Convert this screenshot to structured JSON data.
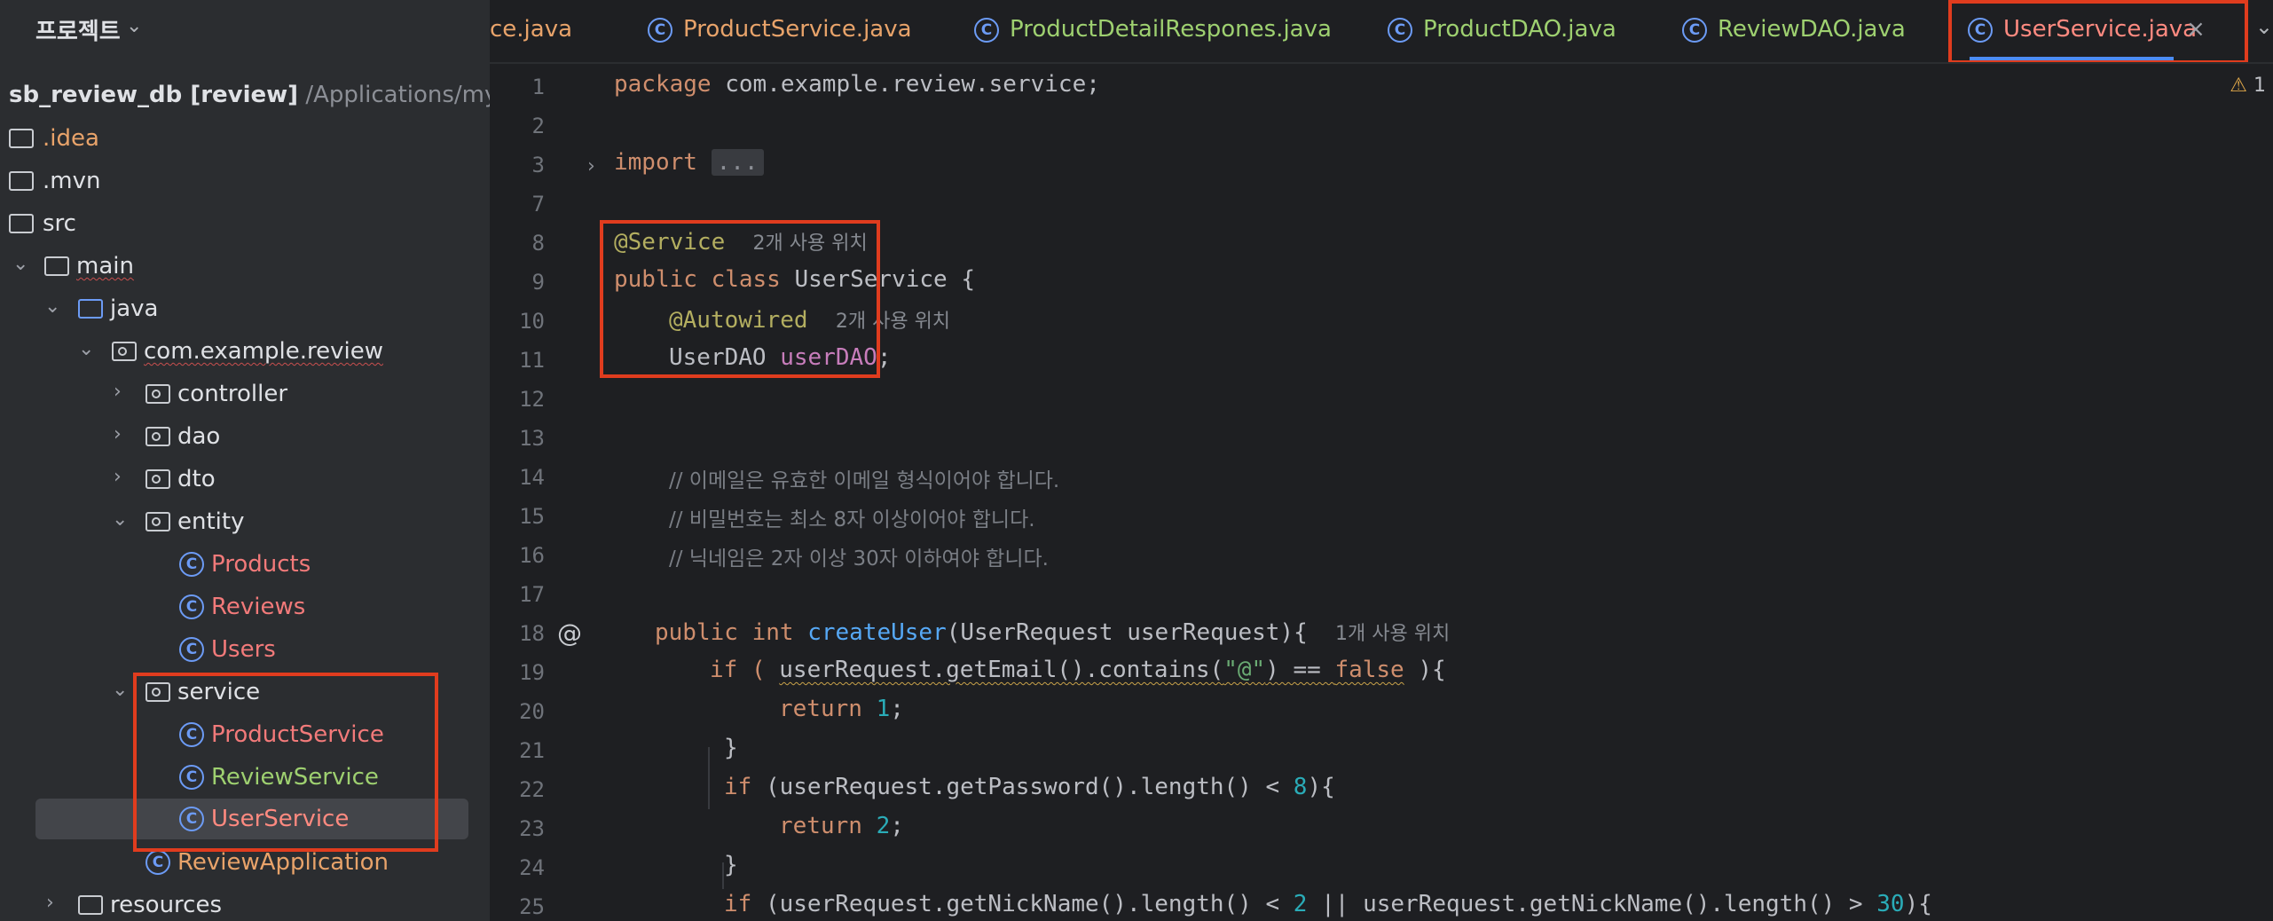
{
  "project_panel": {
    "title": "프로젝트",
    "root": {
      "name": "sb_review_db [review]",
      "path": "/Applications/mybear"
    },
    "items": [
      {
        "label": ".idea"
      },
      {
        "label": ".mvn"
      },
      {
        "label": "src"
      },
      {
        "label": "main"
      },
      {
        "label": "java"
      },
      {
        "label": "com.example.review"
      },
      {
        "label": "controller"
      },
      {
        "label": "dao"
      },
      {
        "label": "dto"
      },
      {
        "label": "entity"
      },
      {
        "label": "Products"
      },
      {
        "label": "Reviews"
      },
      {
        "label": "Users"
      },
      {
        "label": "service"
      },
      {
        "label": "ProductService"
      },
      {
        "label": "ReviewService"
      },
      {
        "label": "UserService"
      },
      {
        "label": "ReviewApplication"
      },
      {
        "label": "resources"
      }
    ]
  },
  "tabs": [
    {
      "label": "ce.java"
    },
    {
      "label": "ProductService.java"
    },
    {
      "label": "ProductDetailRespones.java"
    },
    {
      "label": "ProductDAO.java"
    },
    {
      "label": "ReviewDAO.java"
    },
    {
      "label": "UserService.java",
      "active": true
    }
  ],
  "editor": {
    "warning_count": "1",
    "line_numbers": [
      "1",
      "2",
      "3",
      "7",
      "8",
      "9",
      "10",
      "11",
      "12",
      "13",
      "14",
      "15",
      "16",
      "17",
      "18",
      "19",
      "20",
      "21",
      "22",
      "23",
      "24",
      "25"
    ],
    "lines": {
      "l1": {
        "a": "package ",
        "b": "com.example.review.service;"
      },
      "l3": {
        "a": "import ",
        "b": "..."
      },
      "l8": {
        "a": "@Service",
        "hint": "2개 사용 위치"
      },
      "l9": {
        "a": "public class ",
        "b": "UserService {"
      },
      "l10": {
        "a": "@Autowired",
        "hint": "2개 사용 위치"
      },
      "l11": {
        "a": "UserDAO ",
        "b": "userDAO",
        "c": ";"
      },
      "l14": "// 이메일은 유효한 이메일 형식이어야 합니다.",
      "l15": "// 비밀번호는 최소 8자 이상이어야 합니다.",
      "l16": "// 닉네임은 2자 이상 30자 이하여야 합니다.",
      "l18": {
        "a": "public int ",
        "b": "createUser",
        "c": "(UserRequest userRequest){",
        "hint": "1개 사용 위치"
      },
      "l19": {
        "a": "if ( ",
        "b": "userRequest.getEmail().contains(",
        "c": "\"@\"",
        "d": ") == ",
        "e": "false",
        "f": " ){"
      },
      "l20": {
        "a": "return ",
        "b": "1",
        "c": ";"
      },
      "l21": "}",
      "l22": {
        "a": "if ",
        "b": "(userRequest.getPassword().length() < ",
        "c": "8",
        "d": "){"
      },
      "l23": {
        "a": "return ",
        "b": "2",
        "c": ";"
      },
      "l24": "}",
      "l25": {
        "a": "if ",
        "b": "(userRequest.getNickName().length() < ",
        "c": "2",
        "d": " || userRequest.getNickName().length() > ",
        "e": "30",
        "f": "){"
      }
    }
  },
  "colors": {
    "accent": "#4d8cf5",
    "highlight_box": "#e03c1e",
    "active_tab_text": "#ff8a80"
  }
}
